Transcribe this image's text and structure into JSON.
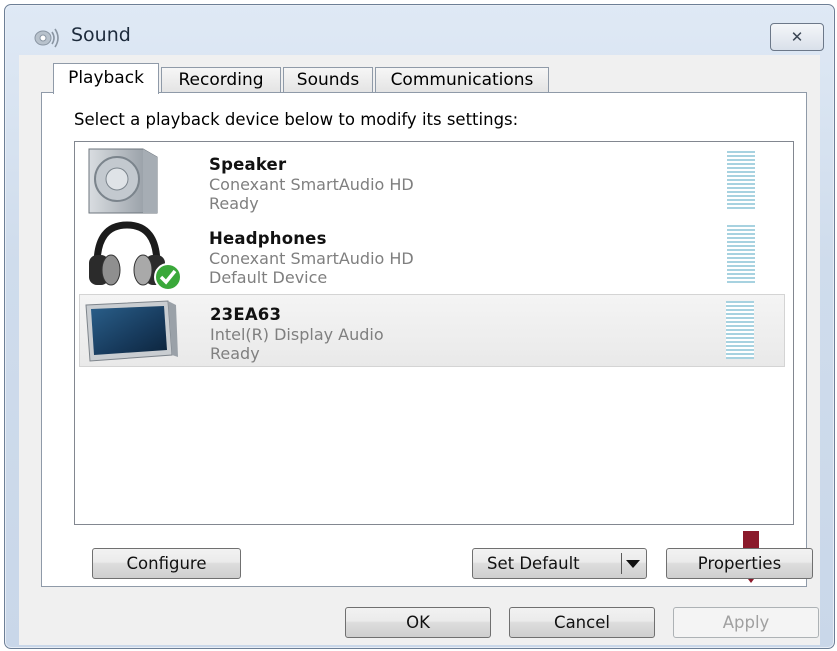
{
  "window": {
    "title": "Sound",
    "close_symbol": "✕"
  },
  "tabs": [
    {
      "label": "Playback",
      "active": true
    },
    {
      "label": "Recording",
      "active": false
    },
    {
      "label": "Sounds",
      "active": false
    },
    {
      "label": "Communications",
      "active": false
    }
  ],
  "playback": {
    "instruction": "Select a playback device below to modify its settings:",
    "devices": [
      {
        "name": "Speaker",
        "driver": "Conexant SmartAudio HD",
        "status": "Ready",
        "icon": "speaker-icon",
        "default": false,
        "selected": false
      },
      {
        "name": "Headphones",
        "driver": "Conexant SmartAudio HD",
        "status": "Default Device",
        "icon": "headphones-icon",
        "default": true,
        "selected": false
      },
      {
        "name": "23EA63",
        "driver": "Intel(R) Display Audio",
        "status": "Ready",
        "icon": "monitor-icon",
        "default": false,
        "selected": true
      }
    ]
  },
  "buttons": {
    "configure": "Configure",
    "set_default": "Set Default",
    "properties": "Properties",
    "ok": "OK",
    "cancel": "Cancel",
    "apply": "Apply"
  },
  "colors": {
    "annotation_arrow": "#8b1a2b",
    "level_meter": "#a7d2e0"
  }
}
